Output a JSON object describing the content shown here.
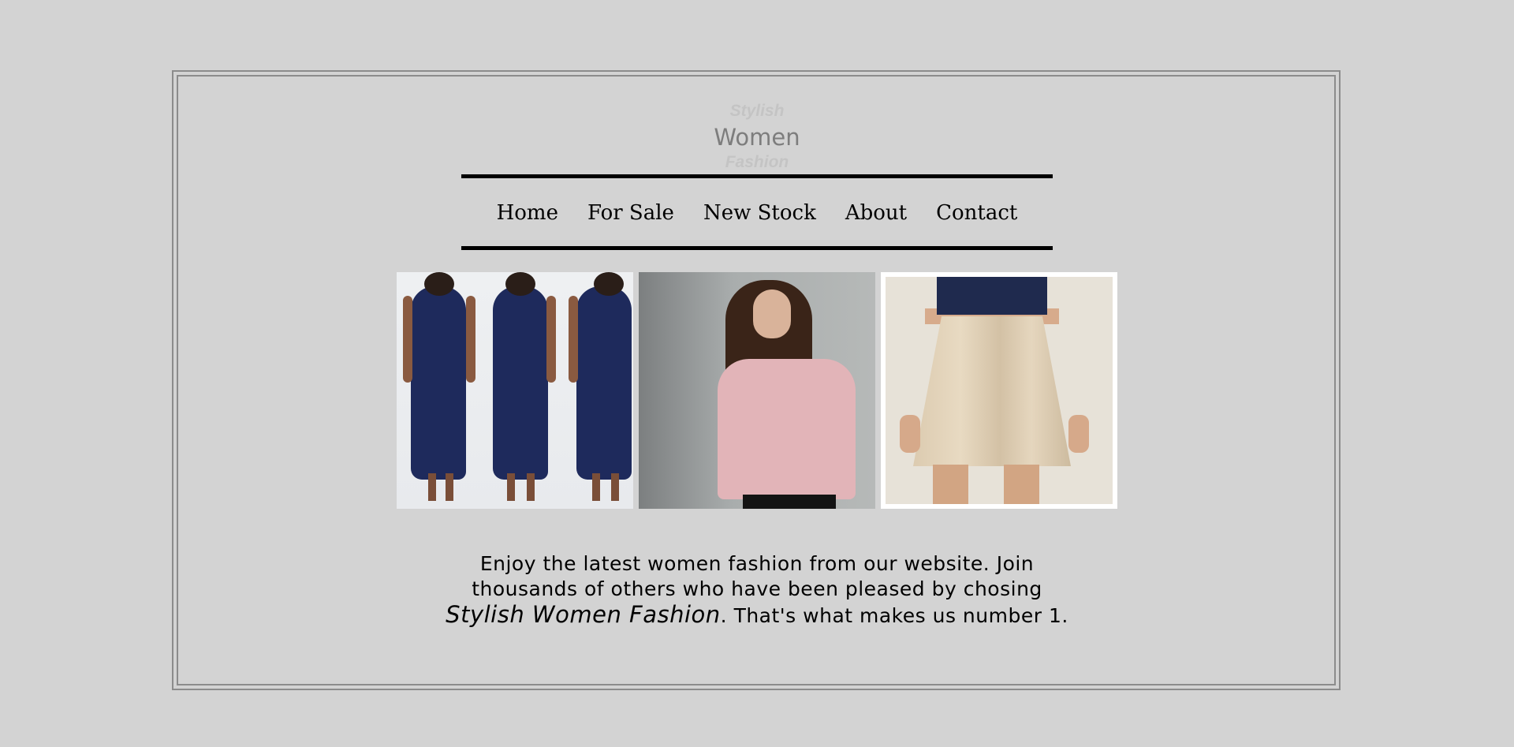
{
  "logo": {
    "line1": "Stylish",
    "line2": "Women",
    "line3": "Fashion"
  },
  "nav": {
    "items": [
      {
        "label": "Home"
      },
      {
        "label": "For Sale"
      },
      {
        "label": "New Stock"
      },
      {
        "label": "About"
      },
      {
        "label": "Contact"
      }
    ]
  },
  "gallery": {
    "images": [
      {
        "subject": "navy lace mermaid dress"
      },
      {
        "subject": "pink button-up blouse"
      },
      {
        "subject": "beige pleated skirt"
      }
    ]
  },
  "tagline": {
    "part1": "Enjoy the latest women fashion from our website. Join thousands of others who have been pleased by chosing",
    "brand": "Stylish Women Fashion",
    "part2": ". That's what makes us number 1."
  },
  "colors": {
    "background": "#d3d3d3",
    "frame_border": "#8c8c8c",
    "rule": "#000000",
    "logo_primary": "#7d7d7d",
    "logo_secondary": "#c4c4c4"
  }
}
